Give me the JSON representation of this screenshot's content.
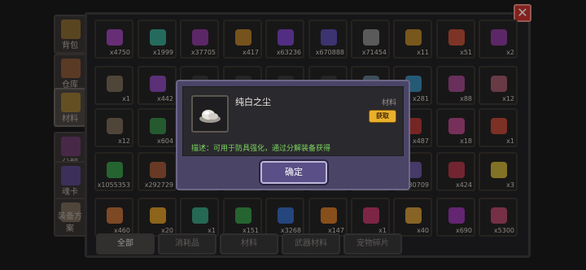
{
  "side_tabs": [
    {
      "label": "背包",
      "color": "#8a6a34"
    },
    {
      "label": "仓库",
      "color": "#8a5a3a"
    },
    {
      "label": "材料",
      "color": "#9a7a36"
    },
    {
      "label": "分解",
      "color": "#6d3f6e"
    },
    {
      "label": "魂卡",
      "color": "#5d4a8a"
    },
    {
      "label": "装备方案",
      "color": "#7a6a5a"
    }
  ],
  "grid_rows": [
    [
      {
        "count": "x4750",
        "color": "#9f47b6"
      },
      {
        "count": "x1999",
        "color": "#3aa58f"
      },
      {
        "count": "x37705",
        "color": "#8e3c9d"
      },
      {
        "count": "x417",
        "color": "#b67e2c"
      },
      {
        "count": "x63236",
        "color": "#7d48c6"
      },
      {
        "count": "x670888",
        "color": "#5d4fae"
      },
      {
        "count": "x71454",
        "color": "#8a8a8a"
      },
      {
        "count": "x11",
        "color": "#b8862d"
      },
      {
        "count": "x51",
        "color": "#c0503a"
      },
      {
        "count": "x2",
        "color": "#8e3c9d"
      }
    ],
    [
      {
        "count": "x1",
        "color": "#7a6a58"
      },
      {
        "count": "x442",
        "color": "#8c4bb7"
      },
      {
        "count": "",
        "color": "#3a3a3a"
      },
      {
        "count": "",
        "color": "#3a3a3a"
      },
      {
        "count": "",
        "color": "#3a3a3a"
      },
      {
        "count": "",
        "color": "#3a3a3a"
      },
      {
        "count": "",
        "color": "#5f7a8a"
      },
      {
        "count": "x281",
        "color": "#3a8ab5"
      },
      {
        "count": "x88",
        "color": "#a04a8a"
      },
      {
        "count": "x12",
        "color": "#a05a6a"
      }
    ],
    [
      {
        "count": "x12",
        "color": "#7a6a58"
      },
      {
        "count": "x604",
        "color": "#3a8a4a"
      },
      {
        "count": "",
        "color": "#3a3a3a"
      },
      {
        "count": "",
        "color": "#3a3a3a"
      },
      {
        "count": "",
        "color": "#3a3a3a"
      },
      {
        "count": "",
        "color": "#3a3a3a"
      },
      {
        "count": "",
        "color": "#3a3a3a"
      },
      {
        "count": "x487",
        "color": "#b53a3a"
      },
      {
        "count": "x18",
        "color": "#b54a8a"
      },
      {
        "count": "x1",
        "color": "#c04a3a"
      }
    ],
    [
      {
        "count": "x1055353",
        "color": "#3a9a4a"
      },
      {
        "count": "x292729",
        "color": "#a05a3a"
      },
      {
        "count": "",
        "color": "#3a3a3a"
      },
      {
        "count": "",
        "color": "#3a3a3a"
      },
      {
        "count": "",
        "color": "#3a3a3a"
      },
      {
        "count": "",
        "color": "#3a3a3a"
      },
      {
        "count": "",
        "color": "#3a3a3a"
      },
      {
        "count": "x30709",
        "color": "#6a5aa0"
      },
      {
        "count": "x424",
        "color": "#b03a4a"
      },
      {
        "count": "x3",
        "color": "#c8b03a"
      }
    ],
    [
      {
        "count": "x460",
        "color": "#c0703a"
      },
      {
        "count": "x20",
        "color": "#d89a2a"
      },
      {
        "count": "x1",
        "color": "#3aa080"
      },
      {
        "count": "x151",
        "color": "#3a9a4a"
      },
      {
        "count": "x3268",
        "color": "#3a6ac0"
      },
      {
        "count": "x147",
        "color": "#d07a2a"
      },
      {
        "count": "x1",
        "color": "#c03a6a"
      },
      {
        "count": "x40",
        "color": "#d09a3a"
      },
      {
        "count": "x690",
        "color": "#9a3ab0"
      },
      {
        "count": "x5300",
        "color": "#b54a6a"
      }
    ]
  ],
  "bottom_tabs": [
    "全部",
    "消耗品",
    "材料",
    "武器材料",
    "宠物碎片"
  ],
  "close_label": "✕",
  "dialog": {
    "item_name": "纯白之尘",
    "item_type": "材料",
    "get_label": "获取",
    "description": "描述：可用于防具强化，通过分解装备获得",
    "ok_label": "确定"
  }
}
